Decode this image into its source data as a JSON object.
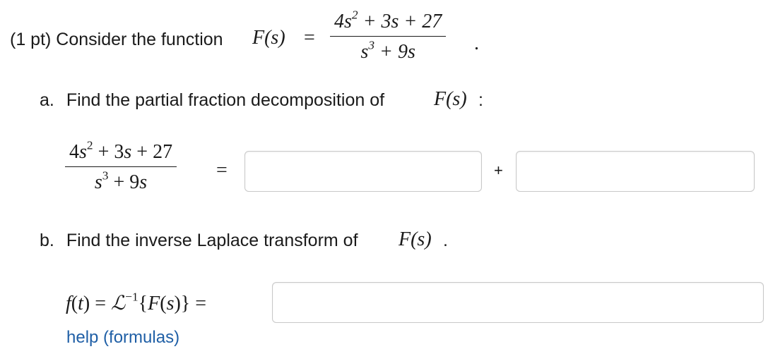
{
  "problem": {
    "intro": "(1 pt) Consider the function",
    "function_lhs": "F(s)",
    "equals": "=",
    "numerator": "4s² + 3s + 27",
    "denominator": "s³ + 9s",
    "period": "."
  },
  "part_a": {
    "label": "a.",
    "text": "Find the partial fraction decomposition of",
    "fn": "F(s)",
    "suffix": ":",
    "numerator": "4s² + 3s + 27",
    "denominator": "s³ + 9s",
    "equals": "=",
    "plus": "+",
    "answer_1": "",
    "answer_2": ""
  },
  "part_b": {
    "label": "b.",
    "text": "Find the inverse Laplace transform of",
    "fn": "F(s)",
    "suffix": ".",
    "expression": "f(t) = ℒ⁻¹{F(s)} =",
    "answer": ""
  },
  "help_link": "help (formulas)",
  "colors": {
    "link": "#1f5fa6",
    "input_border": "#c8c8c8",
    "text": "#1a1a1a"
  }
}
